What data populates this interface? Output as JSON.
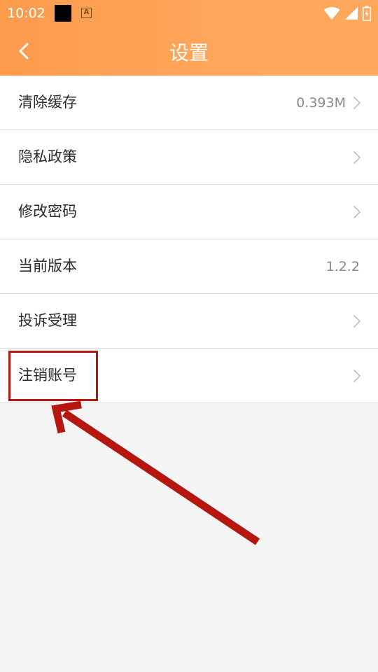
{
  "status_bar": {
    "time": "10:02",
    "icons": [
      "black-square-icon",
      "a-icon",
      "wifi-icon",
      "signal-icon",
      "battery-charging-icon"
    ],
    "a_label": "A"
  },
  "header": {
    "back_icon": "chevron-left-icon",
    "title": "设置"
  },
  "settings": {
    "items": [
      {
        "label": "清除缓存",
        "value": "0.393M",
        "has_chevron": true
      },
      {
        "label": "隐私政策",
        "value": "",
        "has_chevron": true
      },
      {
        "label": "修改密码",
        "value": "",
        "has_chevron": true
      },
      {
        "label": "当前版本",
        "value": "1.2.2",
        "has_chevron": false
      },
      {
        "label": "投诉受理",
        "value": "",
        "has_chevron": true
      },
      {
        "label": "注销账号",
        "value": "",
        "has_chevron": true
      }
    ]
  },
  "annotation": {
    "highlight_color": "#b5170e",
    "arrow_color": "#b5170e",
    "highlighted_item": "注销账号"
  },
  "colors": {
    "header_start": "#fd9a4c",
    "header_end": "#ffa85c",
    "background": "#f4f4f4",
    "divider": "#dcdcdc"
  }
}
